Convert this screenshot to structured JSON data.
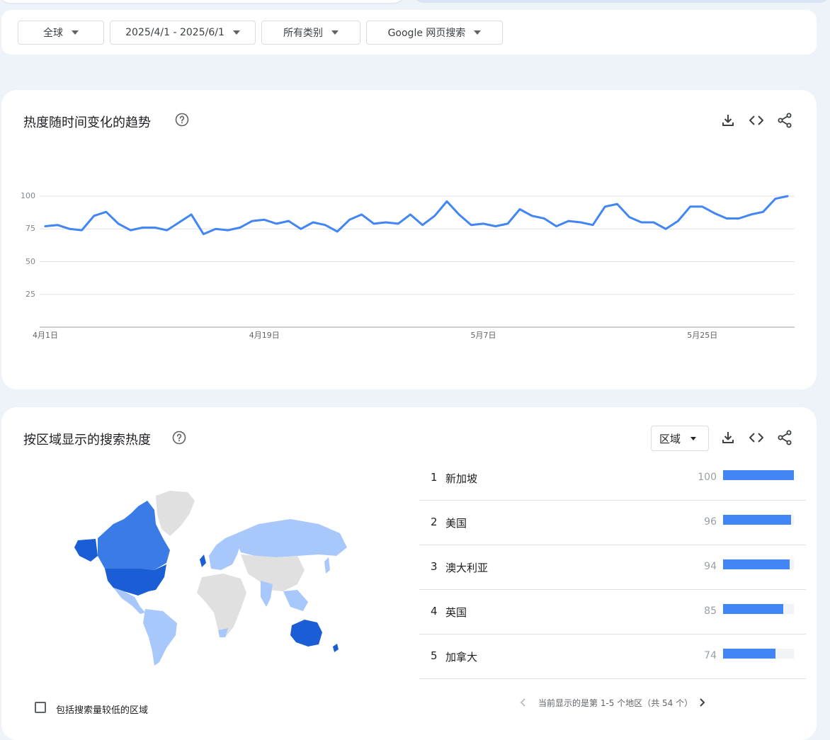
{
  "filters": {
    "location": "全球",
    "date_range": "2025/4/1 - 2025/6/1",
    "category": "所有类别",
    "search_type": "Google 网页搜索"
  },
  "trend": {
    "title": "热度随时间变化的趋势"
  },
  "chart_data": {
    "type": "line",
    "x_labels": [
      "4月1日",
      "4月19日",
      "5月7日",
      "5月25日"
    ],
    "yticks": [
      25,
      50,
      75,
      100
    ],
    "ylim": [
      0,
      100
    ],
    "grid": true,
    "series": [
      {
        "values": [
          77,
          78,
          75,
          74,
          85,
          88,
          79,
          74,
          76,
          76,
          74,
          80,
          86,
          71,
          75,
          74,
          76,
          81,
          82,
          79,
          81,
          75,
          80,
          78,
          73,
          82,
          86,
          79,
          80,
          79,
          86,
          78,
          85,
          96,
          86,
          78,
          79,
          77,
          79,
          90,
          85,
          83,
          77,
          81,
          80,
          78,
          92,
          94,
          84,
          80,
          80,
          75,
          81,
          92,
          92,
          87,
          83,
          83,
          86,
          88,
          98,
          100
        ]
      }
    ],
    "color": "#4285f4"
  },
  "region": {
    "title": "按区域显示的搜索热度",
    "select_label": "区域",
    "rows": [
      {
        "rank": "1",
        "name": "新加坡",
        "value": 100
      },
      {
        "rank": "2",
        "name": "美国",
        "value": 96
      },
      {
        "rank": "3",
        "name": "澳大利亚",
        "value": 94
      },
      {
        "rank": "4",
        "name": "英国",
        "value": 85
      },
      {
        "rank": "5",
        "name": "加拿大",
        "value": 74
      }
    ],
    "pager_text": "当前显示的是第 1-5 个地区（共 54 个）",
    "checkbox_label": "包括搜索量较低的区域"
  },
  "colors": {
    "accent": "#4285f4",
    "map_high": "#1a5dd4",
    "map_mid": "#3b7be6",
    "map_low": "#a8c7fa",
    "map_none": "#e0e0e0"
  }
}
